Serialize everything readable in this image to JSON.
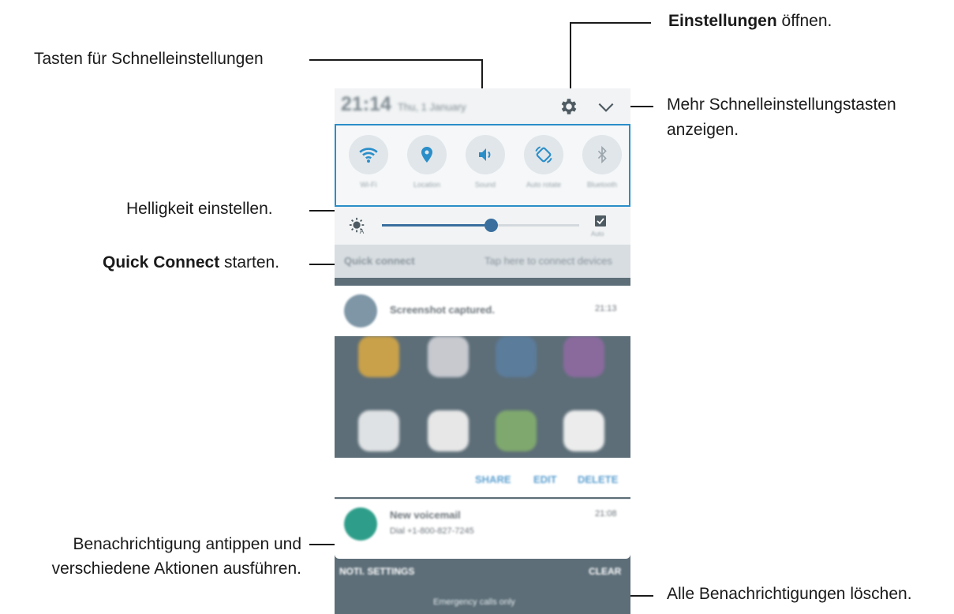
{
  "callouts": {
    "settings_bold": "Einstellungen",
    "settings_rest": " öffnen.",
    "quick_buttons": "Tasten für Schnelleinstellungen",
    "more_line1": "Mehr Schnelleinstellungstasten",
    "more_line2": "anzeigen.",
    "brightness": "Helligkeit einstellen.",
    "quick_connect_bold": "Quick Connect",
    "quick_connect_rest": " starten.",
    "notif_line1": "Benachrichtigung antippen und",
    "notif_line2": "verschiedene Aktionen ausführen.",
    "clear_all": "Alle Benachrichtigungen löschen."
  },
  "phone": {
    "status_time": "21:14",
    "status_date": "Thu, 1 January",
    "quick_settings": [
      {
        "label": "Wi-Fi",
        "icon": "wifi-icon"
      },
      {
        "label": "Location",
        "icon": "location-icon"
      },
      {
        "label": "Sound",
        "icon": "sound-icon"
      },
      {
        "label": "Auto rotate",
        "icon": "auto-rotate-icon"
      },
      {
        "label": "Bluetooth",
        "icon": "bluetooth-icon"
      }
    ],
    "brightness_level": 0.55,
    "auto_label": "Auto",
    "quick_connect_label": "Quick connect",
    "quick_connect_hint": "Tap here to connect devices",
    "screenshot_title": "Screenshot captured.",
    "screenshot_time": "21:13",
    "actions": [
      "SHARE",
      "EDIT",
      "DELETE"
    ],
    "voicemail_title": "New voicemail",
    "voicemail_sub": "Dial +1-800-827-7245",
    "voicemail_time": "21:08",
    "noti_settings": "NOTI. SETTINGS",
    "clear": "CLEAR",
    "emergency": "Emergency calls only"
  },
  "colors": {
    "accent": "#2a8ec9",
    "slider": "#3a6f9e"
  }
}
